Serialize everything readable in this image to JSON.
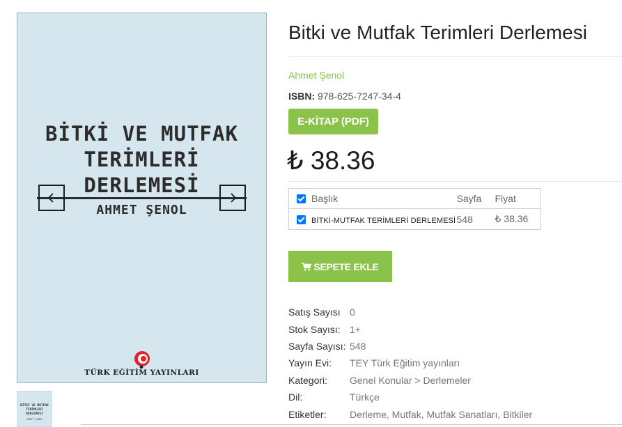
{
  "cover": {
    "title_lines": [
      "BİTKİ VE MUTFAK",
      "TERİMLERİ",
      "DERLEMESİ"
    ],
    "author": "AHMET ŞENOL",
    "publisher": "TÜRK EĞİTİM YAYINLARI",
    "thumbnail": {
      "title_lines": [
        "BİTKİ VE MUTFAK",
        "TERİMLERİ",
        "DERLEMESİ"
      ],
      "author": "AHMET ŞENOL"
    }
  },
  "gallery": {
    "prev_icon": "chevron-left-icon",
    "next_icon": "chevron-right-icon"
  },
  "product": {
    "title": "Bitki ve Mutfak Terimleri Derlemesi",
    "author": "Ahmet Şenol",
    "isbn_label": "ISBN:",
    "isbn_value": "978-625-7247-34-4",
    "format_label": "E-KİTAP (PDF)",
    "price": "₺ 38.36"
  },
  "variants": {
    "headers": [
      "Başlık",
      "Sayfa",
      "Fiyat"
    ],
    "rows": [
      {
        "name": "BİTKİ-MUTFAK TERİMLERİ DERLEMESİ",
        "pages": "548",
        "price": "₺ 38.36"
      }
    ]
  },
  "cart": {
    "label": "SEPETE EKLE",
    "icon": "shopping-cart-icon"
  },
  "meta": [
    {
      "label": "Satış Sayısı",
      "value": "0"
    },
    {
      "label": "Stok Sayısı:",
      "value": "1+"
    },
    {
      "label": "Sayfa Sayısı:",
      "value": "548"
    },
    {
      "label": "Yayın Evi:",
      "value": "TEY Türk Eğitim yayınları"
    },
    {
      "label": "Kategori:",
      "value": "Genel Konular > Derlemeler"
    },
    {
      "label": "Dil:",
      "value": "Türkçe"
    },
    {
      "label": "Etiketler:",
      "value": "Derleme, Mutfak, Mutfak Sanatları, Bitkiler"
    }
  ],
  "colors": {
    "accent": "#8bc34a",
    "checkbox": "#0075ff",
    "cover_bg": "#d6e6ee",
    "logo_red": "#e0242b"
  }
}
